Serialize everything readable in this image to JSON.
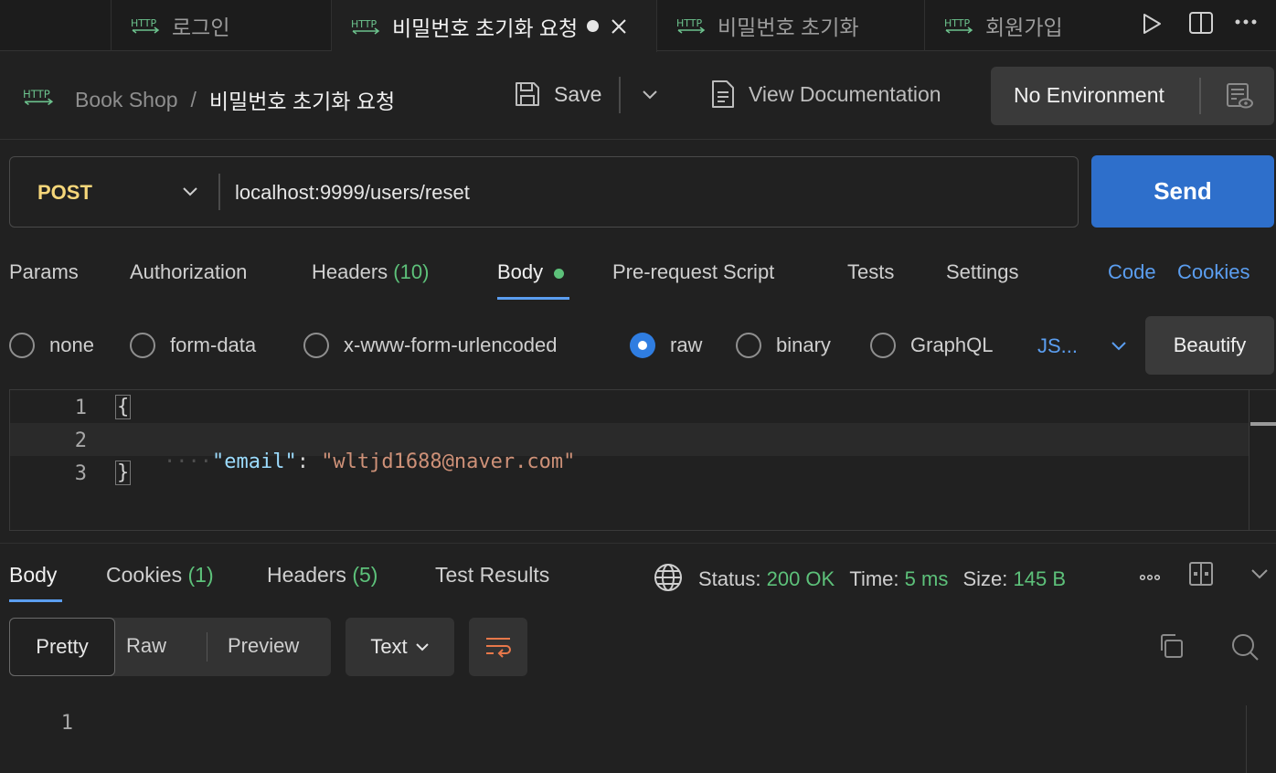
{
  "tabs": [
    {
      "label": "로그인",
      "active": false
    },
    {
      "label": "비밀번호 초기화 요청",
      "active": true,
      "unsaved": true
    },
    {
      "label": "비밀번호 초기화",
      "active": false
    },
    {
      "label": "회원가입",
      "active": false
    }
  ],
  "header": {
    "collection": "Book Shop",
    "separator": "/",
    "request_name": "비밀번호 초기화 요청",
    "save_label": "Save",
    "view_docs_label": "View Documentation",
    "environment": "No Environment"
  },
  "request": {
    "method": "POST",
    "url": "localhost:9999/users/reset",
    "send_label": "Send",
    "tabs": {
      "params": "Params",
      "authorization": "Authorization",
      "headers": "Headers",
      "headers_count": "(10)",
      "body": "Body",
      "prerequest": "Pre-request Script",
      "tests": "Tests",
      "settings": "Settings",
      "code": "Code",
      "cookies": "Cookies"
    },
    "body_types": [
      "none",
      "form-data",
      "x-www-form-urlencoded",
      "raw",
      "binary",
      "GraphQL"
    ],
    "selected_body_type": "raw",
    "language": "JS...",
    "beautify_label": "Beautify",
    "code_lines": [
      "{",
      "\"email\"",
      ": ",
      "\"wltjd1688@naver.com\"",
      "}"
    ],
    "line_numbers": [
      "1",
      "2",
      "3"
    ]
  },
  "response": {
    "tabs": {
      "body": "Body",
      "cookies": "Cookies",
      "cookies_count": "(1)",
      "headers": "Headers",
      "headers_count": "(5)",
      "test_results": "Test Results"
    },
    "status_label": "Status:",
    "status_value": "200 OK",
    "time_label": "Time:",
    "time_value": "5 ms",
    "size_label": "Size:",
    "size_value": "145 B",
    "view_modes": [
      "Pretty",
      "Raw",
      "Preview"
    ],
    "format": "Text",
    "line_numbers": [
      "1"
    ]
  },
  "colors": {
    "accent_blue": "#2e6fcb",
    "method_post": "#f5d67a",
    "success_green": "#5dc17a",
    "link_blue": "#5b9ef0",
    "json_key": "#9cdcfe",
    "json_string": "#ce9178",
    "wrap_icon": "#e8784a"
  }
}
